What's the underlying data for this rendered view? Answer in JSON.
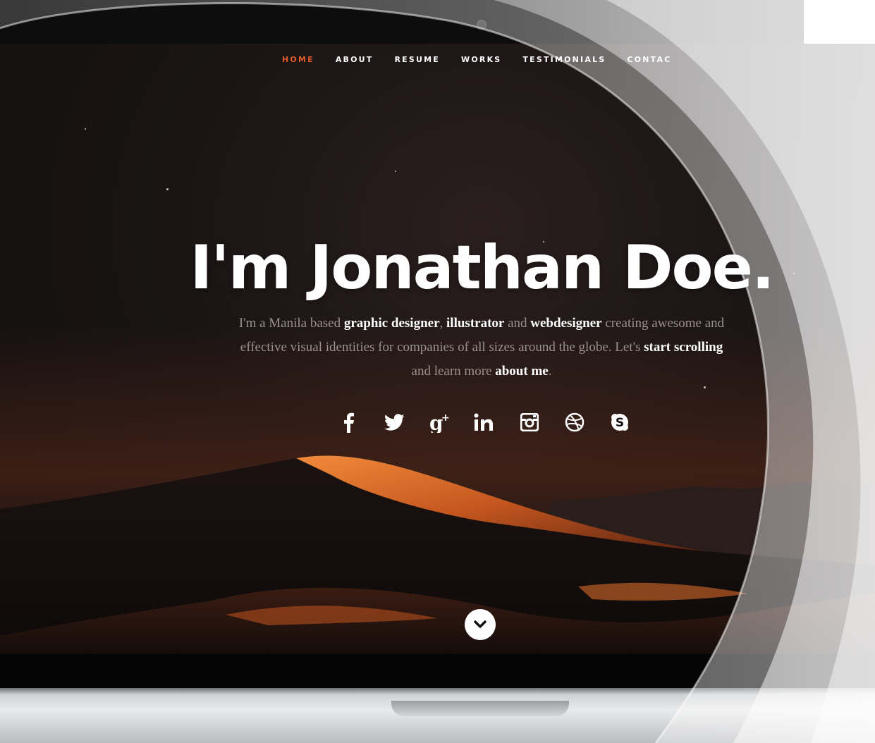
{
  "nav": {
    "items": [
      {
        "label": "HOME",
        "active": true
      },
      {
        "label": "ABOUT",
        "active": false
      },
      {
        "label": "RESUME",
        "active": false
      },
      {
        "label": "WORKS",
        "active": false
      },
      {
        "label": "TESTIMONIALS",
        "active": false
      },
      {
        "label": "CONTAC",
        "active": false
      }
    ]
  },
  "hero": {
    "title": "I'm Jonathan Doe.",
    "intro_parts": [
      {
        "text": "I'm a Manila based ",
        "bold": false
      },
      {
        "text": "graphic designer",
        "bold": true
      },
      {
        "text": ", ",
        "bold": false
      },
      {
        "text": "illustrator",
        "bold": true
      },
      {
        "text": " and ",
        "bold": false
      },
      {
        "text": "webdesigner",
        "bold": true
      },
      {
        "text": " creating awesome and effective visual identities for companies of all sizes around the globe. Let's ",
        "bold": false
      },
      {
        "text": "start scrolling",
        "bold": true
      },
      {
        "text": " and learn more ",
        "bold": false
      },
      {
        "text": "about me",
        "bold": true
      },
      {
        "text": ".",
        "bold": false
      }
    ]
  },
  "social": {
    "icons": [
      "facebook-icon",
      "twitter-icon",
      "google-plus-icon",
      "linkedin-icon",
      "instagram-icon",
      "dribbble-icon",
      "skype-icon"
    ]
  },
  "scroll_button": {
    "icon": "chevron-down-icon"
  },
  "colors": {
    "accent": "#e35a2b",
    "text_white": "#ffffff",
    "text_muted": "#9a918c",
    "background": "#141010"
  }
}
